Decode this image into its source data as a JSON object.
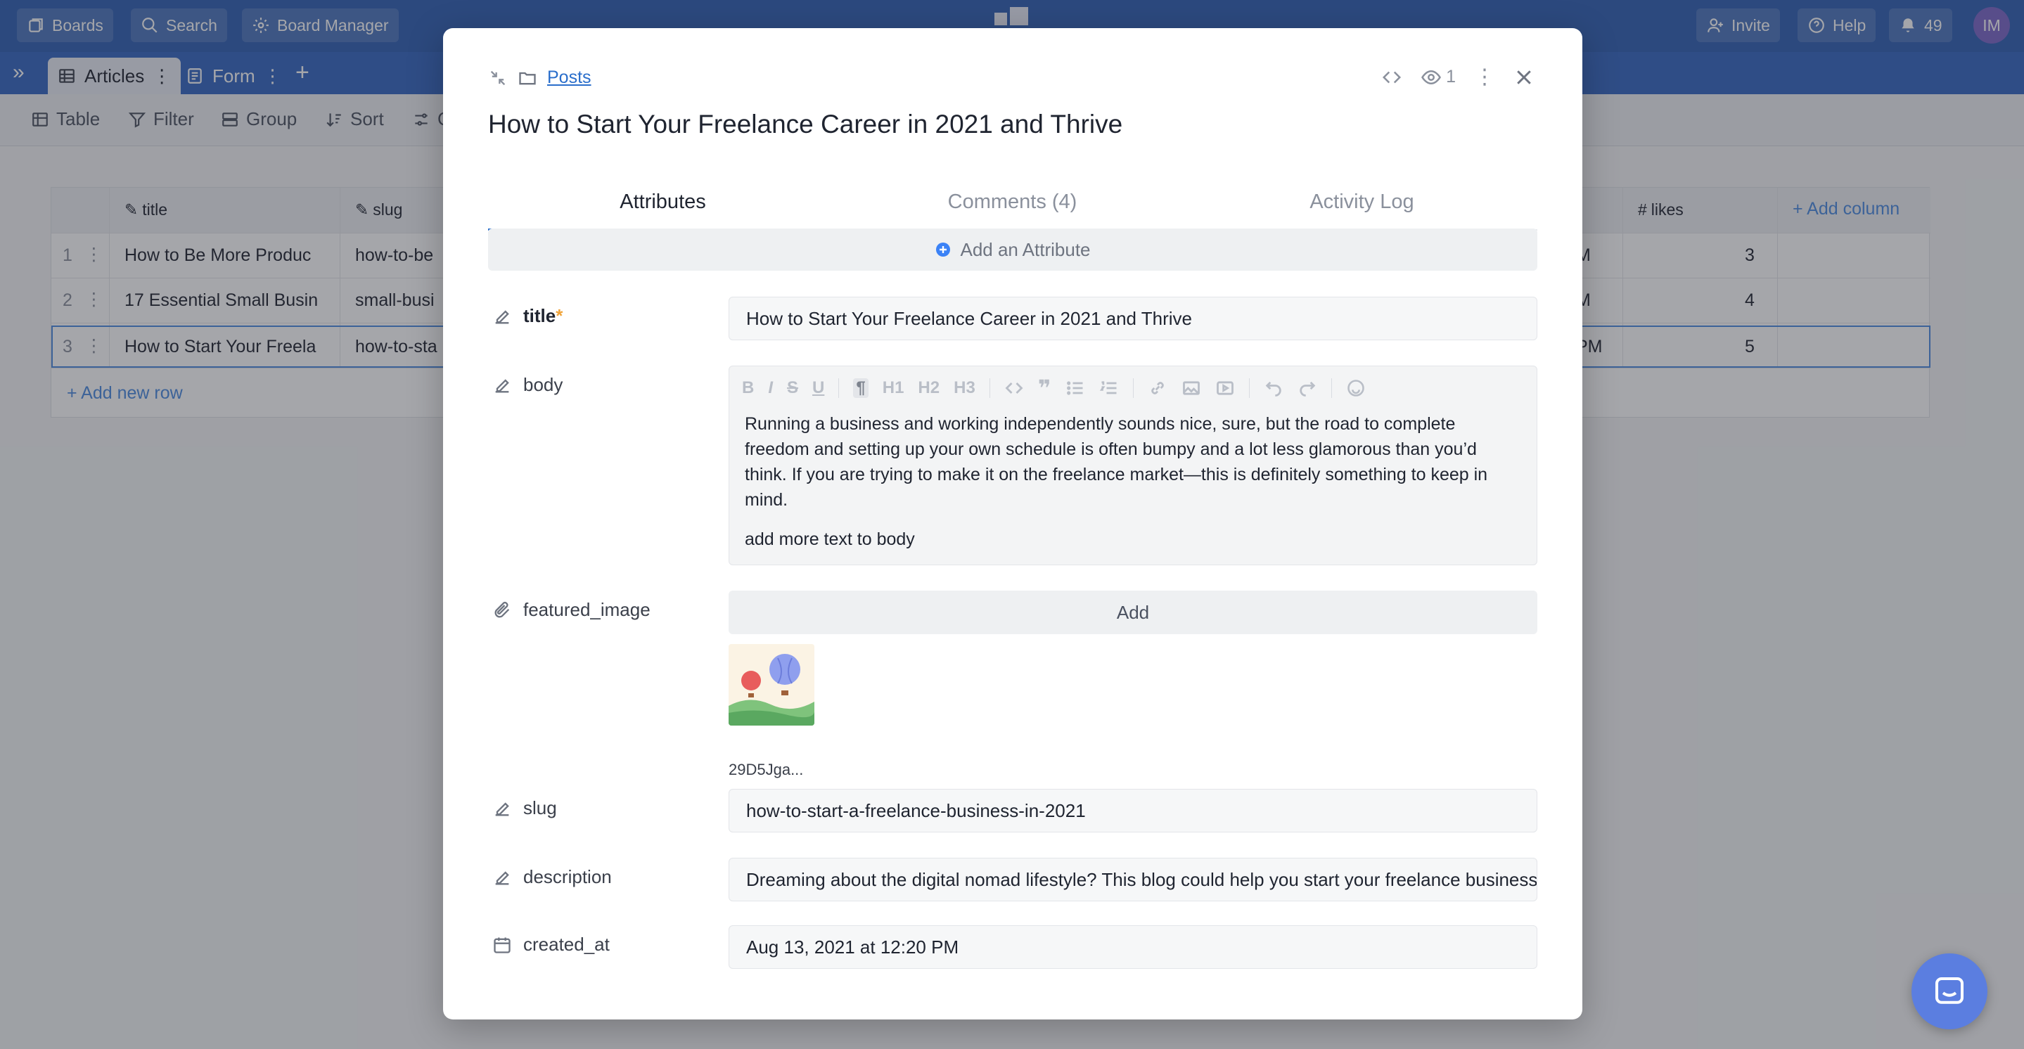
{
  "topbar": {
    "boards_label": "Boards",
    "search_label": "Search",
    "board_manager_label": "Board Manager",
    "invite_label": "Invite",
    "help_label": "Help",
    "notifications_count": "49",
    "avatar_initials": "IM"
  },
  "tabbar": {
    "tabs": [
      {
        "label": "Articles"
      },
      {
        "label": "Form"
      }
    ]
  },
  "toolbar": {
    "table_label": "Table",
    "filter_label": "Filter",
    "group_label": "Group",
    "sort_label": "Sort",
    "more_label": "C"
  },
  "grid": {
    "columns": {
      "title": "title",
      "slug": "slug",
      "likes": "likes",
      "add_column": "+ Add column"
    },
    "rows": [
      {
        "num": "1",
        "title": "How to Be More Produc",
        "slug": "how-to-be",
        "time_tail": "M",
        "likes": "3"
      },
      {
        "num": "2",
        "title": "17 Essential Small Busin",
        "slug": "small-busi",
        "time_tail": "M",
        "likes": "4"
      },
      {
        "num": "3",
        "title": "How to Start Your Freela",
        "slug": "how-to-sta",
        "time_tail": "PM",
        "likes": "5"
      }
    ],
    "add_row_label": "+ Add new row"
  },
  "modal": {
    "breadcrumb": "Posts",
    "viewers_count": "1",
    "title": "How to Start Your Freelance Career in 2021 and Thrive",
    "tabs": [
      {
        "label": "Attributes"
      },
      {
        "label": "Comments (4)"
      },
      {
        "label": "Activity Log"
      }
    ],
    "add_attribute_label": "Add an Attribute",
    "fields": {
      "title": {
        "label": "title",
        "required_mark": "*",
        "value": "How to Start Your Freelance Career in 2021 and Thrive"
      },
      "body": {
        "label": "body",
        "paragraph_1": "Running a business and working independently sounds nice, sure, but the road to complete freedom and setting up your own schedule is often bumpy and a lot less glamorous than you’d think. If you are trying to make it on the freelance market—this is definitely something to keep in mind.",
        "paragraph_2": "add more text to body"
      },
      "featured_image": {
        "label": "featured_image",
        "add_label": "Add",
        "file_name": "29D5Jga..."
      },
      "slug": {
        "label": "slug",
        "value": "how-to-start-a-freelance-business-in-2021"
      },
      "description": {
        "label": "description",
        "value": "Dreaming about the digital nomad lifestyle? This blog could help you start your freelance business"
      },
      "created_at": {
        "label": "created_at",
        "value": "Aug 13, 2021 at 12:20 PM"
      }
    },
    "editor_toolbar": {
      "h1": "H1",
      "h2": "H2",
      "h3": "H3"
    }
  },
  "colors": {
    "topbar": "#2f5fb3",
    "accent": "#2a6ecb",
    "required": "#f0a43a",
    "chat": "#5b7ee0"
  }
}
